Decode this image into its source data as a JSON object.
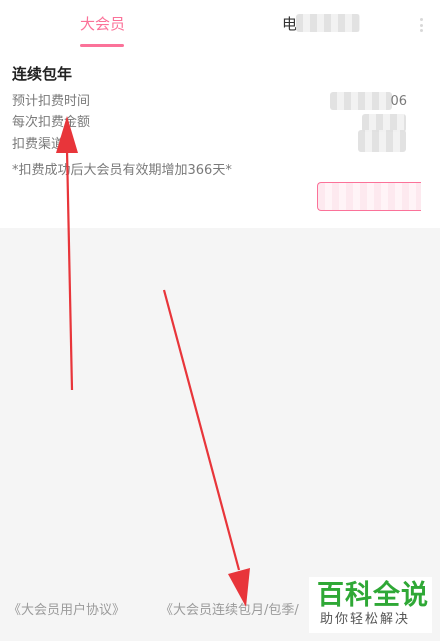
{
  "tabs": [
    {
      "label": "大会员",
      "active": true
    },
    {
      "label": "电"
    }
  ],
  "plan": {
    "title": "连续包年",
    "rows": [
      {
        "label": "预计扣费时间",
        "value": "06"
      },
      {
        "label": "每次扣费金额",
        "value": ""
      },
      {
        "label": "扣费渠道",
        "value": ""
      }
    ],
    "note": "*扣费成功后大会员有效期增加366天*"
  },
  "footer": {
    "links": [
      "《大会员用户协议》",
      "《大会员连续包月/包季/"
    ]
  },
  "watermark": {
    "main": "百科全说",
    "sub": "助你轻松解决"
  },
  "colors": {
    "accent": "#fb7299",
    "annotation_arrow": "#e8353a",
    "watermark_green": "#2fa836"
  }
}
